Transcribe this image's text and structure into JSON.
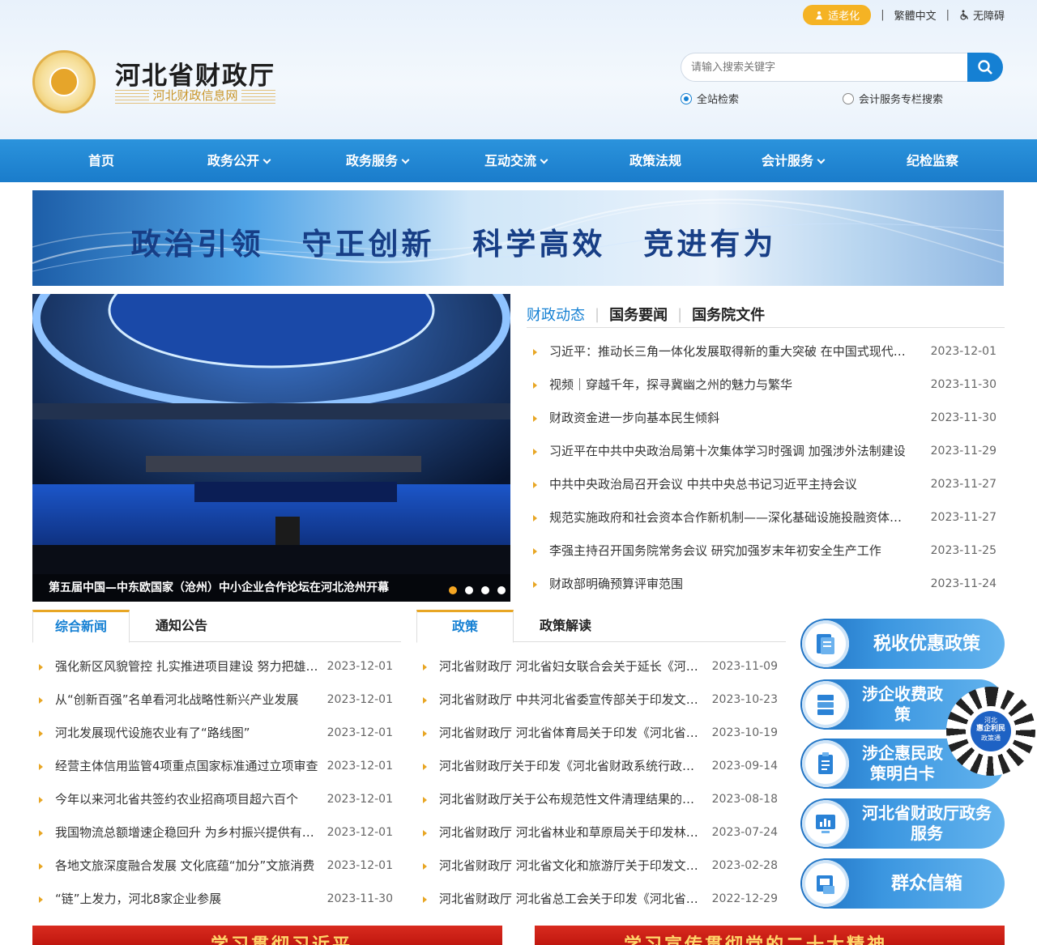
{
  "topbar": {
    "elder_mode": "适老化",
    "traditional": "繁體中文",
    "accessibility": "无障碍"
  },
  "logo": {
    "title": "河北省财政厅",
    "subtitle": "河北财政信息网"
  },
  "search": {
    "placeholder": "请输入搜索关键字",
    "scope_all": "全站检索",
    "scope_accounting": "会计服务专栏搜索"
  },
  "nav": [
    "首页",
    "政务公开",
    "政务服务",
    "互动交流",
    "政策法规",
    "会计服务",
    "纪检监察"
  ],
  "banner": {
    "slogan": "政治引领 守正创新 科学高效 竞进有为"
  },
  "photo": {
    "caption": "第五届中国—中东欧国家（沧州）中小企业合作论坛在河北沧州开幕"
  },
  "news": {
    "tabs": [
      "财政动态",
      "国务要闻",
      "国务院文件"
    ],
    "items": [
      {
        "title": "习近平：推动长三角一体化发展取得新的重大突破 在中国式现代化中更好发挥引领示范作用",
        "date": "2023-12-01"
      },
      {
        "title": "视频｜穿越千年，探寻冀幽之州的魅力与繁华",
        "date": "2023-11-30"
      },
      {
        "title": "财政资金进一步向基本民生倾斜",
        "date": "2023-11-30"
      },
      {
        "title": "习近平在中共中央政治局第十次集体学习时强调 加强涉外法制建设",
        "date": "2023-11-29"
      },
      {
        "title": "中共中央政治局召开会议 中共中央总书记习近平主持会议",
        "date": "2023-11-27"
      },
      {
        "title": "规范实施政府和社会资本合作新机制——深化基础设施投融资体制改革",
        "date": "2023-11-27"
      },
      {
        "title": "李强主持召开国务院常务会议 研究加强岁末年初安全生产工作",
        "date": "2023-11-25"
      },
      {
        "title": "财政部明确预算评审范围",
        "date": "2023-11-24"
      }
    ]
  },
  "composite": {
    "tabs": [
      "综合新闻",
      "通知公告"
    ],
    "items": [
      {
        "title": "强化新区风貌管控 扎实推进项目建设 努力把雄安新区建设成为",
        "date": "2023-12-01"
      },
      {
        "title": "从“创新百强”名单看河北战略性新兴产业发展",
        "date": "2023-12-01"
      },
      {
        "title": "河北发展现代设施农业有了“路线图”",
        "date": "2023-12-01"
      },
      {
        "title": "经营主体信用监管4项重点国家标准通过立项审查",
        "date": "2023-12-01"
      },
      {
        "title": "今年以来河北省共签约农业招商项目超六百个",
        "date": "2023-12-01"
      },
      {
        "title": "我国物流总额增速企稳回升 为乡村振兴提供有力支撑",
        "date": "2023-12-01"
      },
      {
        "title": "各地文旅深度融合发展 文化底蕴“加分”文旅消费",
        "date": "2023-12-01"
      },
      {
        "title": "“链”上发力，河北8家企业参展",
        "date": "2023-11-30"
      }
    ]
  },
  "policy": {
    "tabs": [
      "政策",
      "政策解读"
    ],
    "items": [
      {
        "title": "河北省财政厅 河北省妇女联合会关于延长《河北省巾帼创业贷款》",
        "date": "2023-11-09"
      },
      {
        "title": "河北省财政厅 中共河北省委宣传部关于印发文化产业资金管理办法",
        "date": "2023-10-23"
      },
      {
        "title": "河北省财政厅 河北省体育局关于印发《河北省体育彩票公益金》",
        "date": "2023-10-19"
      },
      {
        "title": "河北省财政厅关于印发《河北省财政系统行政处罚裁量权基准》",
        "date": "2023-09-14"
      },
      {
        "title": "河北省财政厅关于公布规范性文件清理结果的通知",
        "date": "2023-08-18"
      },
      {
        "title": "河北省财政厅 河北省林业和草原局关于印发林业改革发展资金",
        "date": "2023-07-24"
      },
      {
        "title": "河北省财政厅 河北省文化和旅游厅关于印发文旅专项资金办法",
        "date": "2023-02-28"
      },
      {
        "title": "河北省财政厅 河北省总工会关于印发《河北省工会经费》",
        "date": "2022-12-29"
      }
    ]
  },
  "side": [
    {
      "label": "税收优惠政策",
      "icon": "document-icon"
    },
    {
      "label": "涉企收费政策",
      "icon": "database-icon"
    },
    {
      "label": "涉企惠民政策明白卡",
      "icon": "clipboard-icon"
    },
    {
      "label": "河北省财政厅政务服务",
      "icon": "chart-icon"
    },
    {
      "label": "群众信箱",
      "icon": "mailbox-icon"
    }
  ],
  "qr": {
    "line1": "河北",
    "line2": "惠企利民",
    "line3": "政策通"
  },
  "bottom": {
    "left_text": "学习贯彻习近平",
    "right_text": "学习宣传贯彻党的二十大精神"
  },
  "colors": {
    "accent": "#1580d3",
    "nav_bg": "#1a7ccb",
    "bullet": "#e8a624",
    "elder_btn": "#f5b324"
  }
}
